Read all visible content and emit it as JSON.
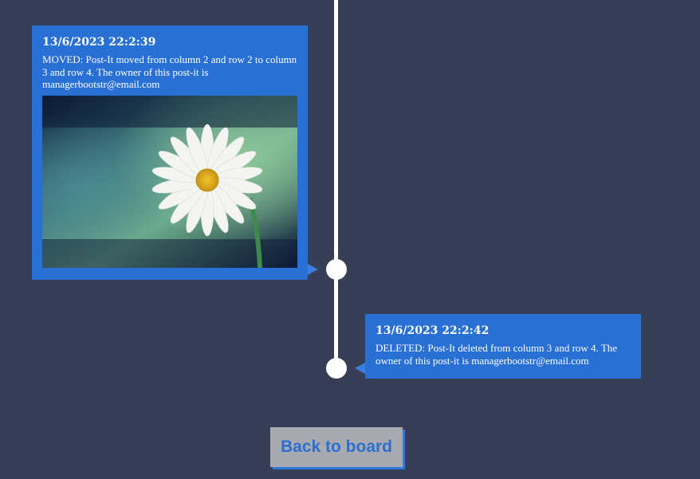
{
  "events": [
    {
      "timestamp": "13/6/2023 22:2:39",
      "description": "MOVED: Post-It moved from column 2 and row 2 to column 3 and row 4. The owner of this post-it is managerbootstr@email.com",
      "image": "white-daisy-photo"
    },
    {
      "timestamp": "13/6/2023 22:2:42",
      "description": "DELETED: Post-It deleted from column 3 and row 4. The owner of this post-it is managerbootstr@email.com"
    }
  ],
  "back_button": {
    "label": "Back to board"
  },
  "colors": {
    "background": "#363f55",
    "card": "#2870d4",
    "line": "#ffffff",
    "button_bg": "#a8aab0",
    "button_text": "#2a6fd1"
  }
}
